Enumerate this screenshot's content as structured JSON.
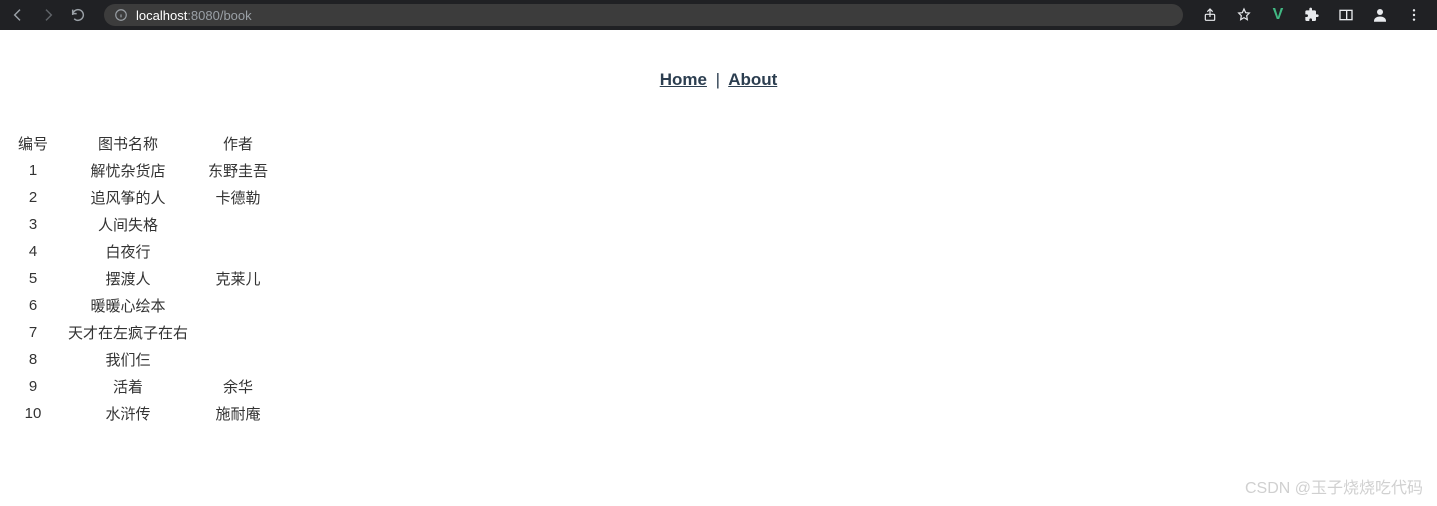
{
  "browser": {
    "url_host": "localhost",
    "url_port_path": ":8080/book"
  },
  "nav": {
    "home": "Home",
    "sep": "|",
    "about": "About"
  },
  "table": {
    "headers": {
      "id": "编号",
      "name": "图书名称",
      "author": "作者"
    },
    "rows": [
      {
        "id": "1",
        "name": "解忧杂货店",
        "author": "东野圭吾"
      },
      {
        "id": "2",
        "name": "追风筝的人",
        "author": "卡德勒"
      },
      {
        "id": "3",
        "name": "人间失格",
        "author": ""
      },
      {
        "id": "4",
        "name": "白夜行",
        "author": ""
      },
      {
        "id": "5",
        "name": "摆渡人",
        "author": "克莱儿"
      },
      {
        "id": "6",
        "name": "暖暖心绘本",
        "author": ""
      },
      {
        "id": "7",
        "name": "天才在左疯子在右",
        "author": ""
      },
      {
        "id": "8",
        "name": "我们仨",
        "author": ""
      },
      {
        "id": "9",
        "name": "活着",
        "author": "余华"
      },
      {
        "id": "10",
        "name": "水浒传",
        "author": "施耐庵"
      }
    ]
  },
  "watermark": "CSDN @玉子烧烧吃代码"
}
